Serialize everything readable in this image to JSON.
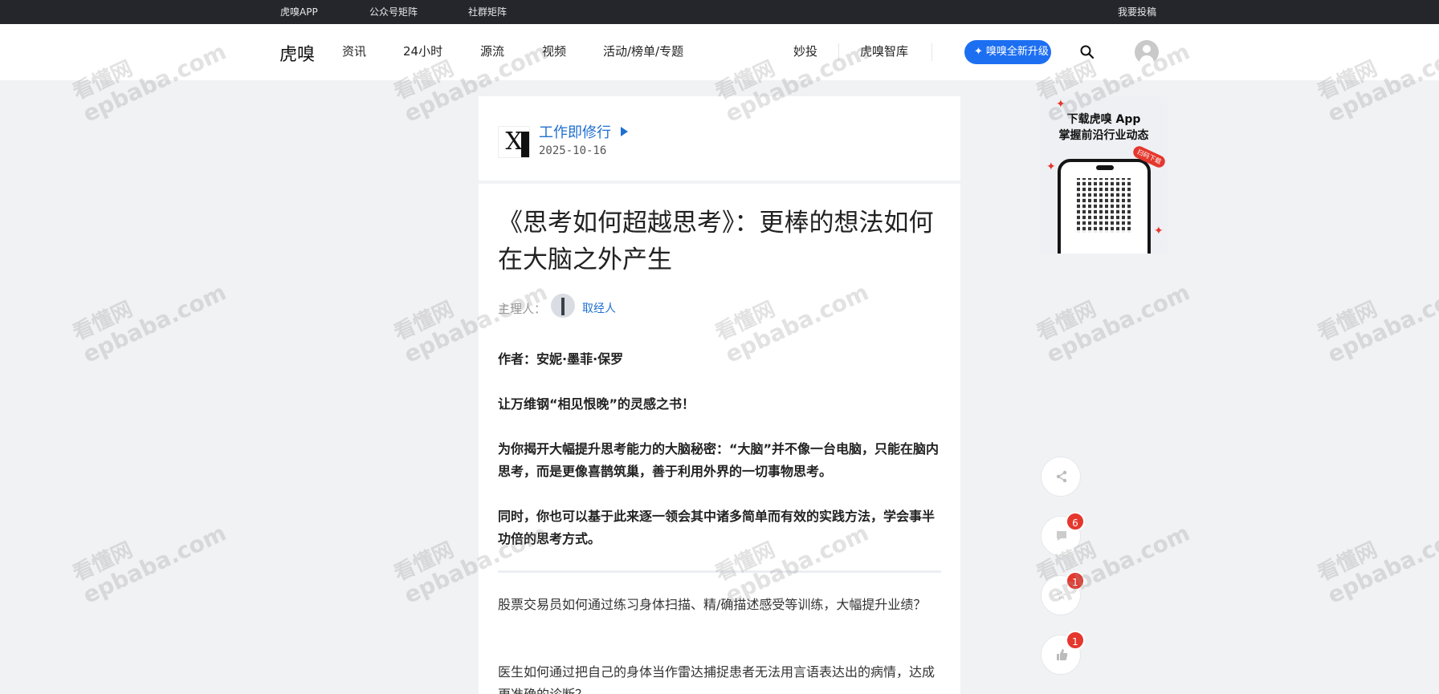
{
  "topbar": {
    "app": "虎嗅APP",
    "wechat": "公众号矩阵",
    "community": "社群矩阵",
    "submit": "我要投稿"
  },
  "nav": {
    "logo": "虎嗅",
    "items": [
      "资讯",
      "24小时",
      "源流",
      "视频",
      "活动/榜单/专题",
      "妙投",
      "虎嗅智库"
    ],
    "upgrade_label": "嗅嗅全新升级"
  },
  "author": {
    "name": "工作即修行",
    "date": "2025-10-16",
    "logo_char": "X"
  },
  "article": {
    "title": "《思考如何超越思考》：更棒的想法如何在大脑之外产生",
    "editor_label": "主理人：",
    "editor_name": "取经人",
    "p1": "作者：安妮·墨菲·保罗",
    "p2": "让万维钢“相见恨晚”的灵感之书！",
    "p3": "为你揭开大幅提升思考能力的大脑秘密：“大脑”并不像一台电脑，只能在脑内思考，而是更像喜鹊筑巢，善于利用外界的一切事物思考。",
    "p4": "同时，你也可以基于此来逐一领会其中诸多简单而有效的实践方法，学会事半功倍的思考方式。",
    "q1": "股票交易员如何通过练习身体扫描、精/确描述感受等训练，大幅提升业绩？",
    "q2": "医生如何通过把自己的身体当作雷达捕捉患者无法用言语表达出的病情，达成更准确的诊断？"
  },
  "ad": {
    "line1": "下载虎嗅 App",
    "line2": "掌握前沿行业动态",
    "scan": "扫码下载"
  },
  "side": {
    "comment_count": "6",
    "collect_count": "1",
    "like_count": "1"
  },
  "watermark": {
    "cn": "看懂网",
    "en": "epbaba.com"
  }
}
